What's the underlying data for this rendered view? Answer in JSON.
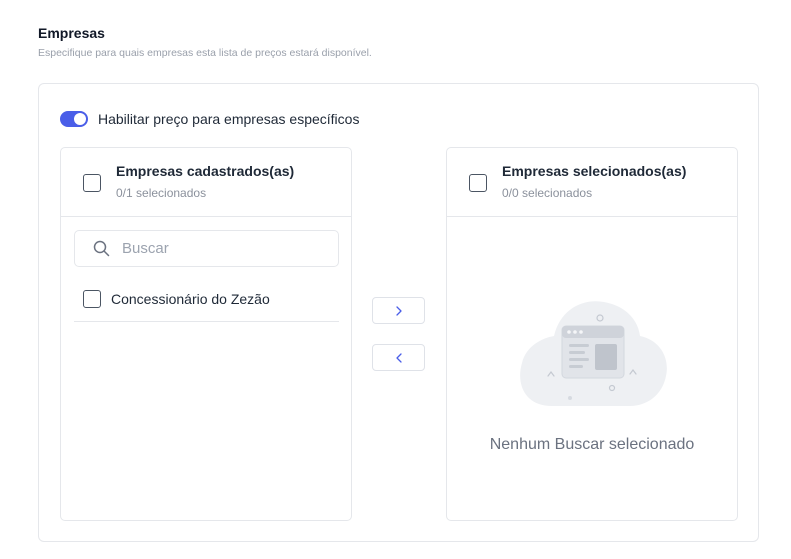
{
  "section": {
    "title": "Empresas",
    "description": "Especifique para quais empresas esta lista de preços estará disponível."
  },
  "toggle": {
    "label": "Habilitar preço para empresas específicos",
    "enabled": true,
    "accent_color": "#4a5ee8"
  },
  "source_panel": {
    "title": "Empresas cadastrados(as)",
    "count": "0/1 selecionados",
    "search": {
      "placeholder": "Buscar",
      "value": "",
      "icon": "search-icon"
    },
    "items": [
      {
        "label": "Concessionário do Zezão",
        "checked": false
      }
    ]
  },
  "transfer": {
    "to_right_icon": "chevron-right-icon",
    "to_left_icon": "chevron-left-icon"
  },
  "target_panel": {
    "title": "Empresas selecionados(as)",
    "count": "0/0 selecionados",
    "empty_text": "Nenhum Buscar selecionado",
    "empty_icon": "empty-browser-illustration"
  }
}
